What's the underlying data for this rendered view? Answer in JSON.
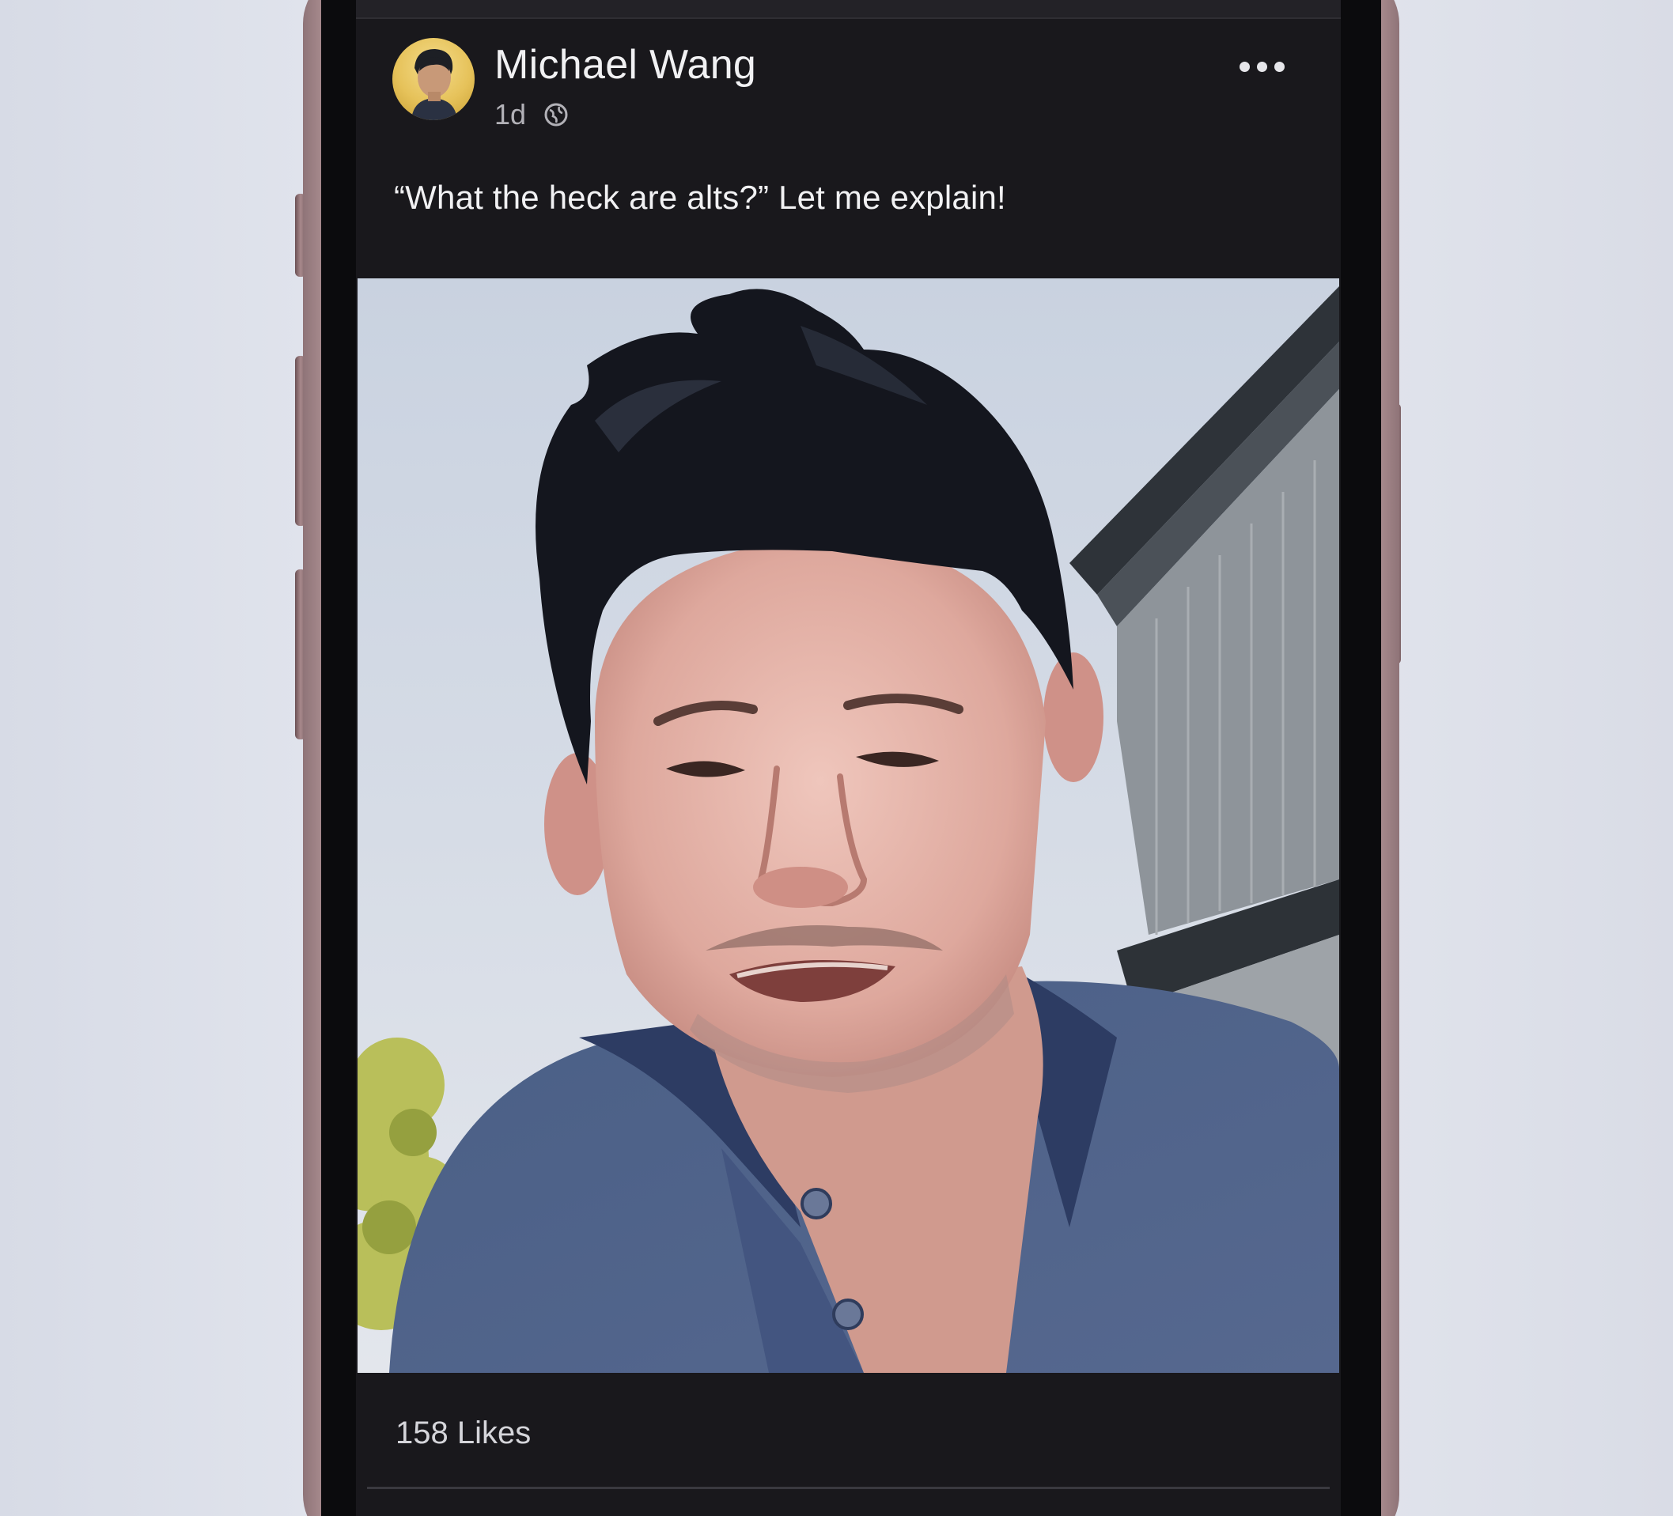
{
  "post": {
    "author_name": "Michael Wang",
    "timestamp": "1d",
    "audience_icon": "globe-icon",
    "more_icon": "more-options-icon",
    "text": "“What the heck are alts?” Let me explain!",
    "likes": "158 Likes"
  },
  "colors": {
    "screen_background": "#19181c",
    "text_primary": "#f1f1f3",
    "text_secondary": "#b2b1b7"
  }
}
